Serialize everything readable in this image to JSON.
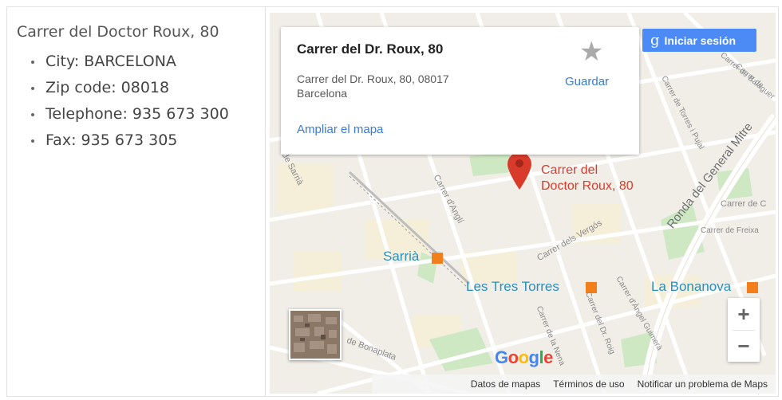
{
  "info": {
    "title": "Carrer del Doctor Roux, 80",
    "items": [
      "City: BARCELONA",
      "Zip code: 08018",
      "Telephone: 935 673 300",
      "Fax: 935 673 305"
    ]
  },
  "map": {
    "card": {
      "title": "Carrer del Dr. Roux, 80",
      "address_line1": "Carrer del Dr. Roux, 80, 08017",
      "address_line2": "Barcelona",
      "save_label": "Guardar",
      "save_icon": "star-icon",
      "expand_link": "Ampliar el mapa"
    },
    "signin": {
      "icon": "g",
      "label": "Iniciar sesión"
    },
    "marker": {
      "line1": "Carrer del",
      "line2": "Doctor Roux, 80"
    },
    "neighborhoods": {
      "sarria": "Sarrià",
      "tres_torres": "Les Tres Torres",
      "bonanova": "La Bonanova"
    },
    "streets": {
      "sarria": "de Sarrià",
      "angli": "Carrer d'Anglí",
      "vergos": "Carrer dels Vergós",
      "ronda": "Ronda del General Mitre",
      "freixa": "Carrer de Freixa",
      "carrer_de_c": "Carrer de C",
      "torres": "Carrer de Torres i Pujal",
      "bonaplata": "de Bonaplata",
      "nena": "Carrer de la Nena",
      "roig": "Carrer del Dr. Roig",
      "guimera": "Carrer d'Àngel Guimerà",
      "balaguer": "Carrer de Balaguer",
      "carrer_de": "Carrer de"
    },
    "zoom": {
      "in": "+",
      "out": "−"
    },
    "google_logo": "Google",
    "footer": {
      "data": "Datos de mapas",
      "terms": "Términos de uso",
      "report": "Notificar un problema de Maps"
    },
    "colors": {
      "link": "#3a7bd5",
      "signin_bg": "#4c8bf5",
      "marker": "#d93b2b",
      "neighborhood": "#2a8fbd"
    }
  }
}
